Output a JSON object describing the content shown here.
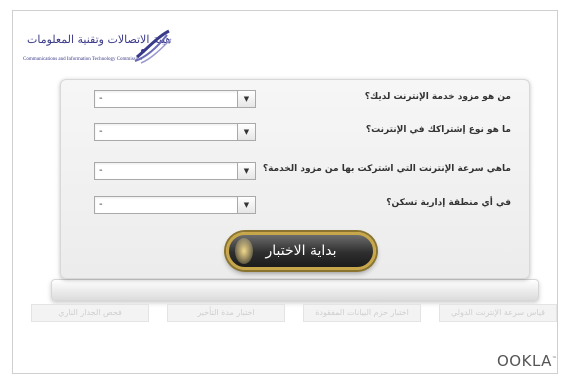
{
  "logo": {
    "arabic_name": "هيئة الاتصالات وتقنية المعلومات",
    "english_name": "Communications and Information Technology Commission",
    "icon": "citc-swirl-icon"
  },
  "questions": [
    {
      "label": "من هو مزود خدمة الإنترنت لديك؟",
      "value": "-"
    },
    {
      "label": "ما هو نوع إشتراكك في الإنترنت؟",
      "value": "-"
    },
    {
      "label": "ماهي سرعة الإنترنت التي اشتركت بها من مزود الخدمة؟",
      "value": "-"
    },
    {
      "label": "في أي منطقة إدارية تسكن؟",
      "value": "-"
    }
  ],
  "start_button": {
    "label": "بداية الاختبار"
  },
  "tabs": [
    {
      "label": "فحص الجدار الناري"
    },
    {
      "label": "اختبار مدة التأخير"
    },
    {
      "label": "اختبار حزم البيانات المفقودة"
    },
    {
      "label": "قياس سرعة الإنترنت الدولي"
    }
  ],
  "footer": {
    "brand": "OOKLA",
    "trademark": "™"
  },
  "colors": {
    "button_border": "#c8a64a",
    "button_bg": "#2e2e2e",
    "logo_blue": "#3a3a8a"
  }
}
